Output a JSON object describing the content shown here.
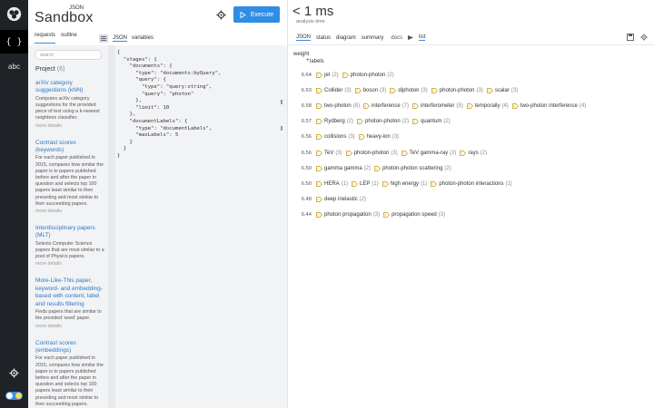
{
  "brand": {
    "sup": "JSON",
    "name": "Sandbox"
  },
  "toolbar": {
    "execute_label": "Execute"
  },
  "left_tabs": [
    "requests",
    "outline"
  ],
  "mid_tabs": [
    "JSON",
    "variables"
  ],
  "rail": {
    "json_label": "{ }",
    "abc_label": "abc"
  },
  "sidebar": {
    "search_placeholder": "search",
    "project_label": "Project",
    "project_count": "(6)",
    "cards": [
      {
        "title": "arXiv category suggestions (kNN)",
        "desc": "Computes arXiv category suggestions for the provided piece of text using a k-nearest neighbors classifier.",
        "more": "more details"
      },
      {
        "title": "Contrast scores (keywords)",
        "desc": "For each paper published in 2015, compares how similar the paper is to papers published before and after the paper in question and selects top 100 papers least similar to their preceding and most similar to their succeeding papers.",
        "more": "more details"
      },
      {
        "title": "Interdisciplinary papers (MLT)",
        "desc": "Selects Computer Science papers that are most similar to a pool of Physics papers.",
        "more": "more details"
      },
      {
        "title": "More-Like-This paper, keyword- and embedding-based with content, label and results filtering",
        "desc": "Finds papers that are similar to the provided 'seed' paper.",
        "more": "more details"
      },
      {
        "title": "Contrast scores (embeddings)",
        "desc": "For each paper published in 2015, compares how similar the paper is to papers published before and after the paper in question and selects top 100 papers least similar to their preceding and most similar to their succeeding papers.",
        "more": ""
      }
    ]
  },
  "result": {
    "time": "< 1 ms",
    "time_sub": "analysis time",
    "tabs": [
      "JSON",
      "status",
      "diagram",
      "summary"
    ],
    "doc_label": "docs",
    "list_tab": "list",
    "weight_header": "weight",
    "plus": "+",
    "labels_header": "labels",
    "rows": [
      {
        "w": "6.64",
        "tags": [
          [
            "jet",
            "(2)"
          ],
          [
            "photon-photon",
            "(2)"
          ]
        ]
      },
      {
        "w": "6.63",
        "tags": [
          [
            "Collider",
            "(3)"
          ],
          [
            "boson",
            "(3)"
          ],
          [
            "diphoton",
            "(3)"
          ],
          [
            "photon-photon",
            "(3)"
          ],
          [
            "scalar",
            "(3)"
          ]
        ]
      },
      {
        "w": "6.58",
        "tags": [
          [
            "two-photon",
            "(8)"
          ],
          [
            "interference",
            "(7)"
          ],
          [
            "interferometer",
            "(5)"
          ],
          [
            "temporally",
            "(4)"
          ],
          [
            "two-photon interference",
            "(4)"
          ]
        ]
      },
      {
        "w": "6.57",
        "tags": [
          [
            "Rydberg",
            "(2)"
          ],
          [
            "photon-photon",
            "(2)"
          ],
          [
            "quantum",
            "(2)"
          ]
        ]
      },
      {
        "w": "6.56",
        "tags": [
          [
            "collisions",
            "(3)"
          ],
          [
            "heavy-ion",
            "(3)"
          ]
        ]
      },
      {
        "w": "6.56",
        "tags": [
          [
            "TeV",
            "(3)"
          ],
          [
            "photon-photon",
            "(3)"
          ],
          [
            "TeV gamma-ray",
            "(2)"
          ],
          [
            "rays",
            "(2)"
          ]
        ]
      },
      {
        "w": "6.50",
        "tags": [
          [
            "gamma gamma",
            "(2)"
          ],
          [
            "photon-photon scattering",
            "(2)"
          ]
        ]
      },
      {
        "w": "6.50",
        "tags": [
          [
            "HERA",
            "(1)"
          ],
          [
            "LEP",
            "(1)"
          ],
          [
            "high energy",
            "(1)"
          ],
          [
            "photon-photon interactions",
            "(1)"
          ]
        ]
      },
      {
        "w": "6.48",
        "tags": [
          [
            "deep inelastic",
            "(2)"
          ]
        ]
      },
      {
        "w": "6.44",
        "tags": [
          [
            "photon propagation",
            "(3)"
          ],
          [
            "propagation speed",
            "(3)"
          ]
        ]
      }
    ]
  },
  "code_lines": [
    "{",
    "  \"stages\": {",
    "    \"documents\": {",
    "      \"type\": \"documents:byQuery\",",
    "      \"query\": {",
    "        \"type\": \"query:string\",",
    "        \"query\": \"photon\"",
    "      },",
    "      \"limit\": 10",
    "    },",
    "    \"documentLabels\": {",
    "      \"type\": \"documentLabels\",",
    "      \"maxLabels\": 5",
    "    }",
    "  }",
    "}"
  ],
  "colors": {
    "accent": "#2f8de4",
    "rail_bg": "#1f2226",
    "panel_bg": "#f2f3f5",
    "link": "#2f78c4"
  }
}
